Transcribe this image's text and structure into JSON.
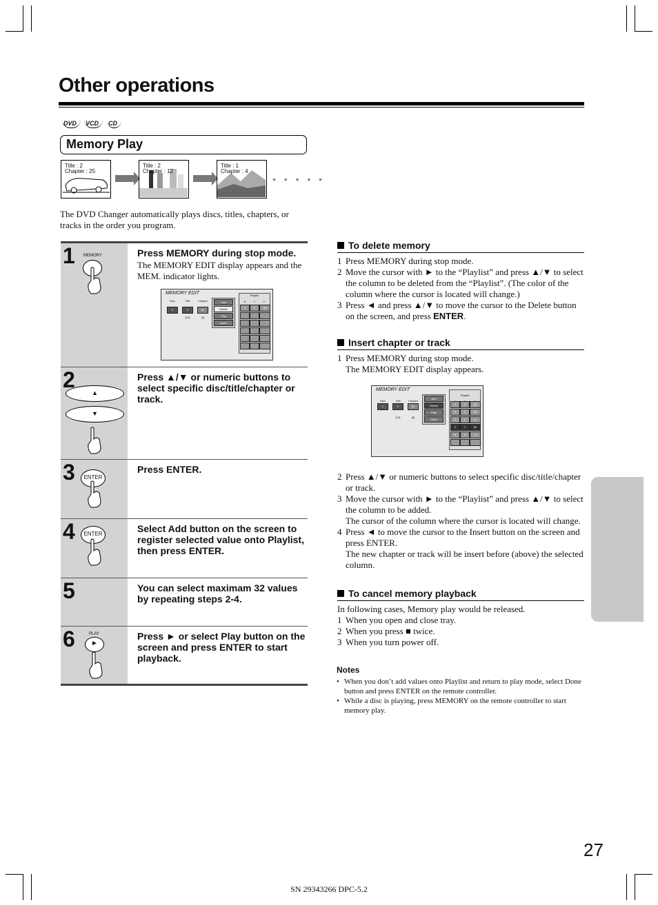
{
  "page_title": "Other operations",
  "disc_icons": [
    "DVD",
    "VCD",
    "CD"
  ],
  "section_title": "Memory Play",
  "thumbnails": [
    {
      "title": "Title : 2",
      "chapter": "Chapter : 25"
    },
    {
      "title": "Title : 2",
      "chapter": "Chapter : 12"
    },
    {
      "title": "Title : 1",
      "chapter": "Chapter : 4"
    }
  ],
  "ellipsis": "• • • • •",
  "intro": "The DVD Changer automatically plays discs, titles, chapters, or tracks in the order you program.",
  "steps": [
    {
      "num": "1",
      "heading": "Press MEMORY during stop mode.",
      "body": "The MEMORY EDIT display appears and the MEM. indicator lights.",
      "button": "MEMORY"
    },
    {
      "num": "2",
      "heading": "Press ▲/▼ or numeric buttons to select specific disc/title/chapter or track.",
      "up": "▲",
      "down": "▼"
    },
    {
      "num": "3",
      "heading": "Press ENTER.",
      "button": "ENTER"
    },
    {
      "num": "4",
      "heading": "Select Add button on the screen to register selected value onto Playlist, then press ENTER.",
      "button": "ENTER"
    },
    {
      "num": "5",
      "heading": "You can select maximam 32 values by repeating steps 2-4."
    },
    {
      "num": "6",
      "heading": "Press ► or select Play button on the screen and press ENTER to start playback.",
      "button": "PLAY",
      "button_glyph": "►"
    }
  ],
  "screens": [
    {
      "title": "MEMORY EDIT",
      "labels": [
        "Disc",
        "Title",
        "Chapter"
      ],
      "values": [
        "2",
        "2",
        "All"
      ],
      "title_count": "[12]",
      "chapter_count": "[3]",
      "buttons": [
        "Add",
        "Delete",
        "Play",
        "Done"
      ],
      "highlight": "Delete",
      "playlist_label": "Playlist",
      "cols": [
        "D",
        "T",
        "C"
      ],
      "rows": [
        [
          "2",
          "2",
          "All"
        ],
        [
          "",
          "",
          ""
        ],
        [
          "",
          "",
          ""
        ],
        [
          "",
          "",
          ""
        ],
        [
          "",
          "",
          ""
        ],
        [
          "",
          "",
          ""
        ]
      ]
    },
    {
      "title": "MEMORY EDIT",
      "labels": [
        "Disc",
        "Title",
        "Chapter"
      ],
      "values": [
        "1",
        "2",
        "All"
      ],
      "title_count": "[12]",
      "chapter_count": "[3]",
      "buttons": [
        "Add",
        "Delete",
        "Play",
        "Done"
      ],
      "highlight": "Delete",
      "playlist_label": "Playlist",
      "cols": [
        "D",
        "T",
        "C"
      ],
      "rows": [
        [
          "1",
          "2",
          "All"
        ],
        [
          "4",
          "3",
          "12"
        ],
        [
          "2",
          "1",
          "6"
        ],
        [
          "1",
          "1",
          "All"
        ],
        [
          "5",
          "3",
          "5"
        ],
        [
          "",
          "",
          ""
        ]
      ]
    }
  ],
  "delete": {
    "heading": "To delete memory",
    "items": [
      {
        "n": "1",
        "t": "Press MEMORY during stop mode."
      },
      {
        "n": "2",
        "t": "Move the cursor with ► to the “Playlist” and press ▲/▼ to select the column to be deleted from the “Playlist”. (The color of the column where the cursor is located will change.)"
      },
      {
        "n": "3",
        "t": "Press ◄ and press ▲/▼ to move the cursor to the Delete button on the screen, and press",
        "bold": "ENTER",
        "end": "."
      }
    ]
  },
  "insert": {
    "heading": "Insert chapter or track",
    "items": [
      {
        "n": "1",
        "t": "Press MEMORY during stop mode.",
        "t2": "The MEMORY EDIT display appears."
      },
      {
        "n": "2",
        "t": "Press ▲/▼ or numeric buttons to select specific disc/title/chapter or track."
      },
      {
        "n": "3",
        "t": "Move the cursor with ► to the “Playlist” and press ▲/▼ to select the column to be added.",
        "t2": "The cursor of the column where the cursor is located will change."
      },
      {
        "n": "4",
        "t": "Press ◄ to move the cursor to the Insert button on the screen and press ENTER.",
        "t2": "The new chapter or track will be insert before (above) the selected column."
      }
    ]
  },
  "cancel": {
    "heading": "To cancel memory playback",
    "lead": "In following cases, Memory play would be released.",
    "items": [
      {
        "n": "1",
        "t": "When you open and close tray."
      },
      {
        "n": "2",
        "t": "When you press ■ twice."
      },
      {
        "n": "3",
        "t": "When you turn power off."
      }
    ]
  },
  "notes": {
    "heading": "Notes",
    "items": [
      "When you don’t add values onto Playlist and return to play mode, select Done button and press ENTER on the remote controller.",
      "While a disc is playing, press MEMORY on the remote controller to start memory play."
    ]
  },
  "page_number": "27",
  "footer": "SN 29343266 DPC-5.2"
}
